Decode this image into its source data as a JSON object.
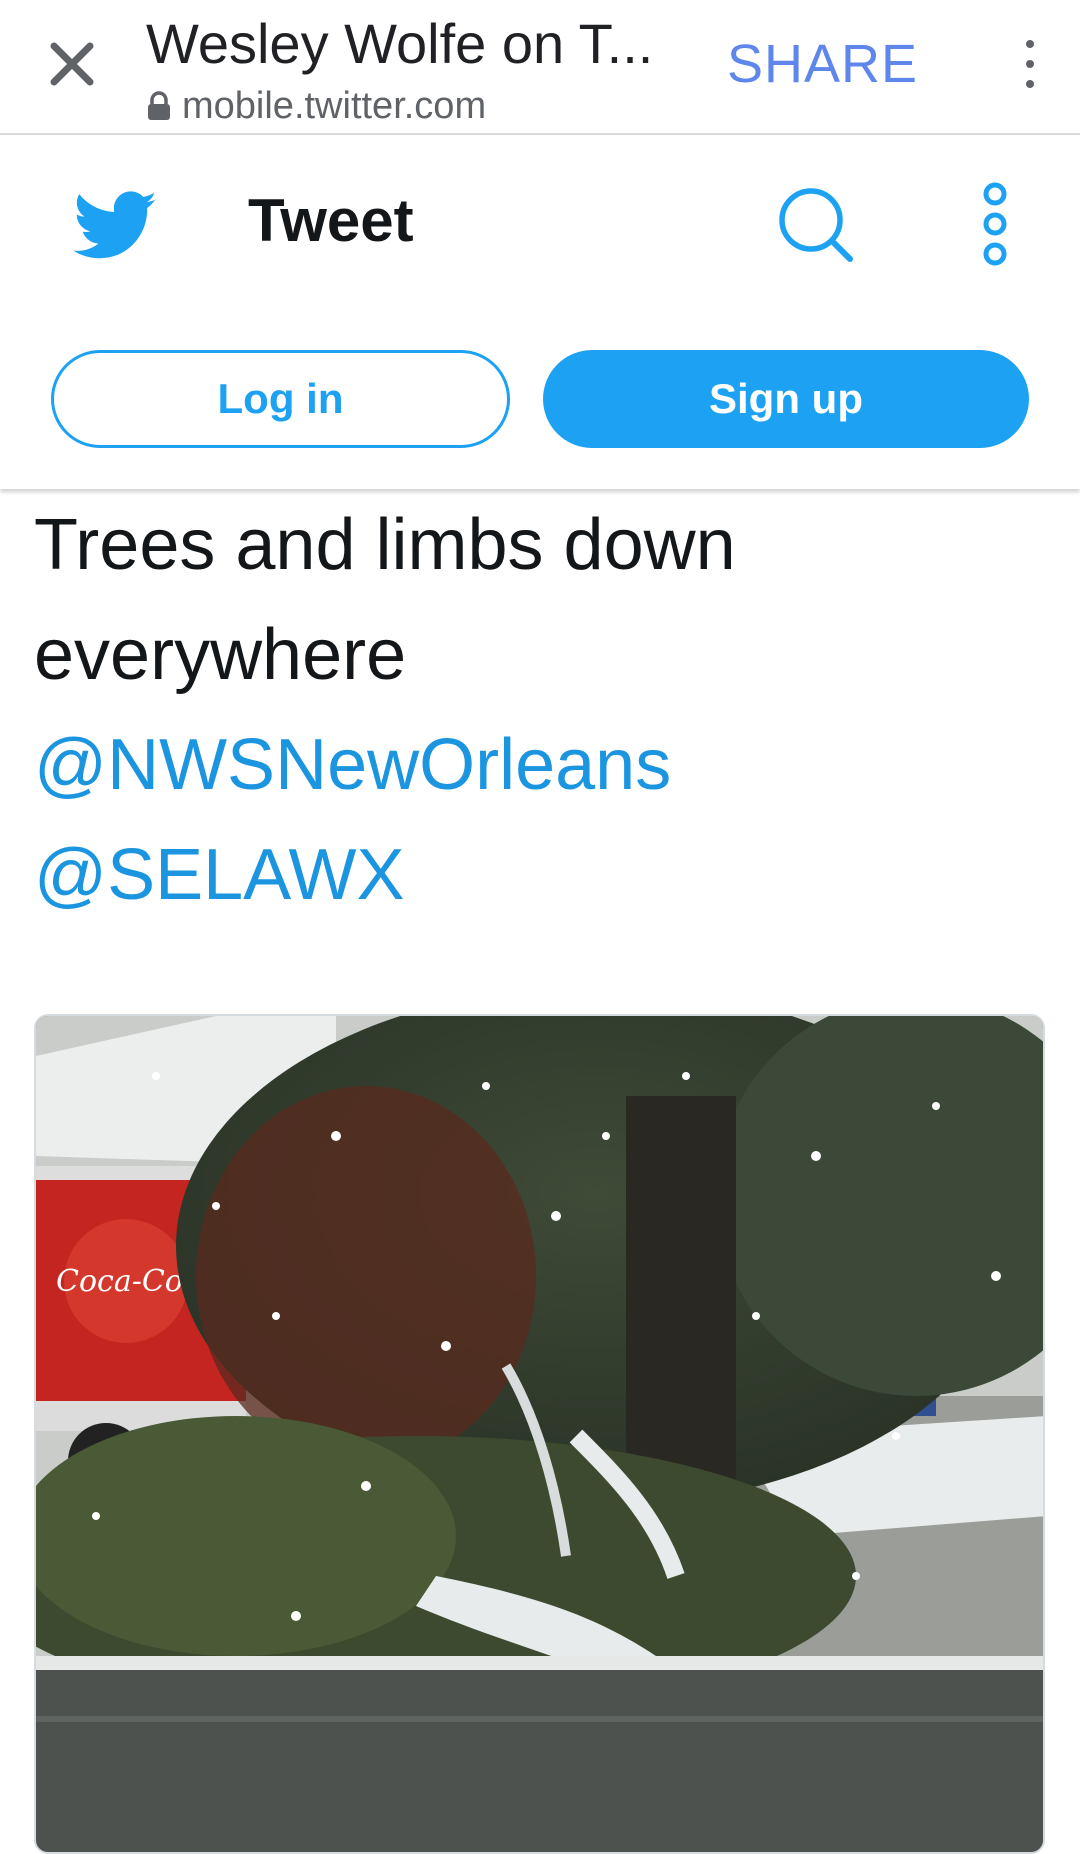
{
  "browser": {
    "close_icon": "close-icon",
    "page_title": "Wesley Wolfe on T...",
    "url": "mobile.twitter.com",
    "lock_icon": "lock-icon",
    "share_label": "SHARE",
    "menu_icon": "vertical-dots-icon"
  },
  "twitter_header": {
    "logo_icon": "twitter-bird-icon",
    "title": "Tweet",
    "search_icon": "search-icon",
    "more_icon": "more-options-icon",
    "login_label": "Log in",
    "signup_label": "Sign up",
    "accent_color": "#1da1f2"
  },
  "tweet": {
    "text_line1": "Trees and limbs down",
    "text_line2": "everywhere",
    "mention1": "@NWSNewOrleans",
    "mention2": "@SELAWX",
    "mention_color": "#1b95e0"
  },
  "photo": {
    "logo_text": "Coca-Cola"
  }
}
